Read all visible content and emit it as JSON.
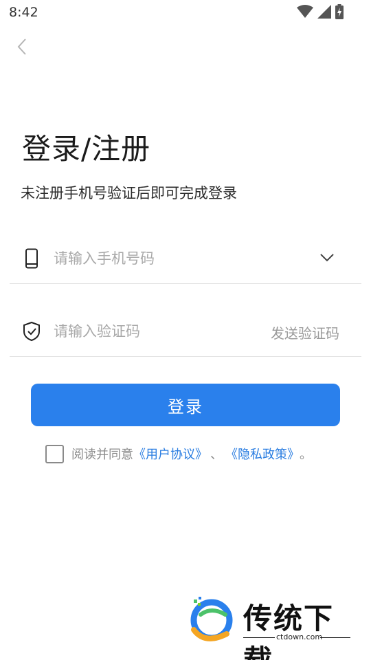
{
  "status_bar": {
    "time": "8:42",
    "icons": [
      "wifi-icon",
      "signal-icon",
      "battery-charging-icon"
    ]
  },
  "header": {
    "back_icon": "chevron-left-icon"
  },
  "page": {
    "title": "登录/注册",
    "subtitle": "未注册手机号验证后即可完成登录"
  },
  "form": {
    "phone": {
      "icon": "phone-icon",
      "placeholder": "请输入手机号码",
      "value": "",
      "dropdown_icon": "chevron-down-icon"
    },
    "code": {
      "icon": "shield-check-icon",
      "placeholder": "请输入验证码",
      "value": "",
      "send_label": "发送验证码"
    },
    "login_label": "登录"
  },
  "agreement": {
    "checked": false,
    "prefix": "阅读并同意",
    "user_agreement": "《用户协议》",
    "separator": "、",
    "privacy_policy": "《隐私政策》",
    "suffix": "。"
  },
  "watermark": {
    "name": "传统下载",
    "url": "ctdown.com"
  },
  "colors": {
    "primary": "#2a80ec",
    "link": "#2a7de1",
    "placeholder": "#a9a9a9",
    "divider": "#e3e3e3"
  }
}
